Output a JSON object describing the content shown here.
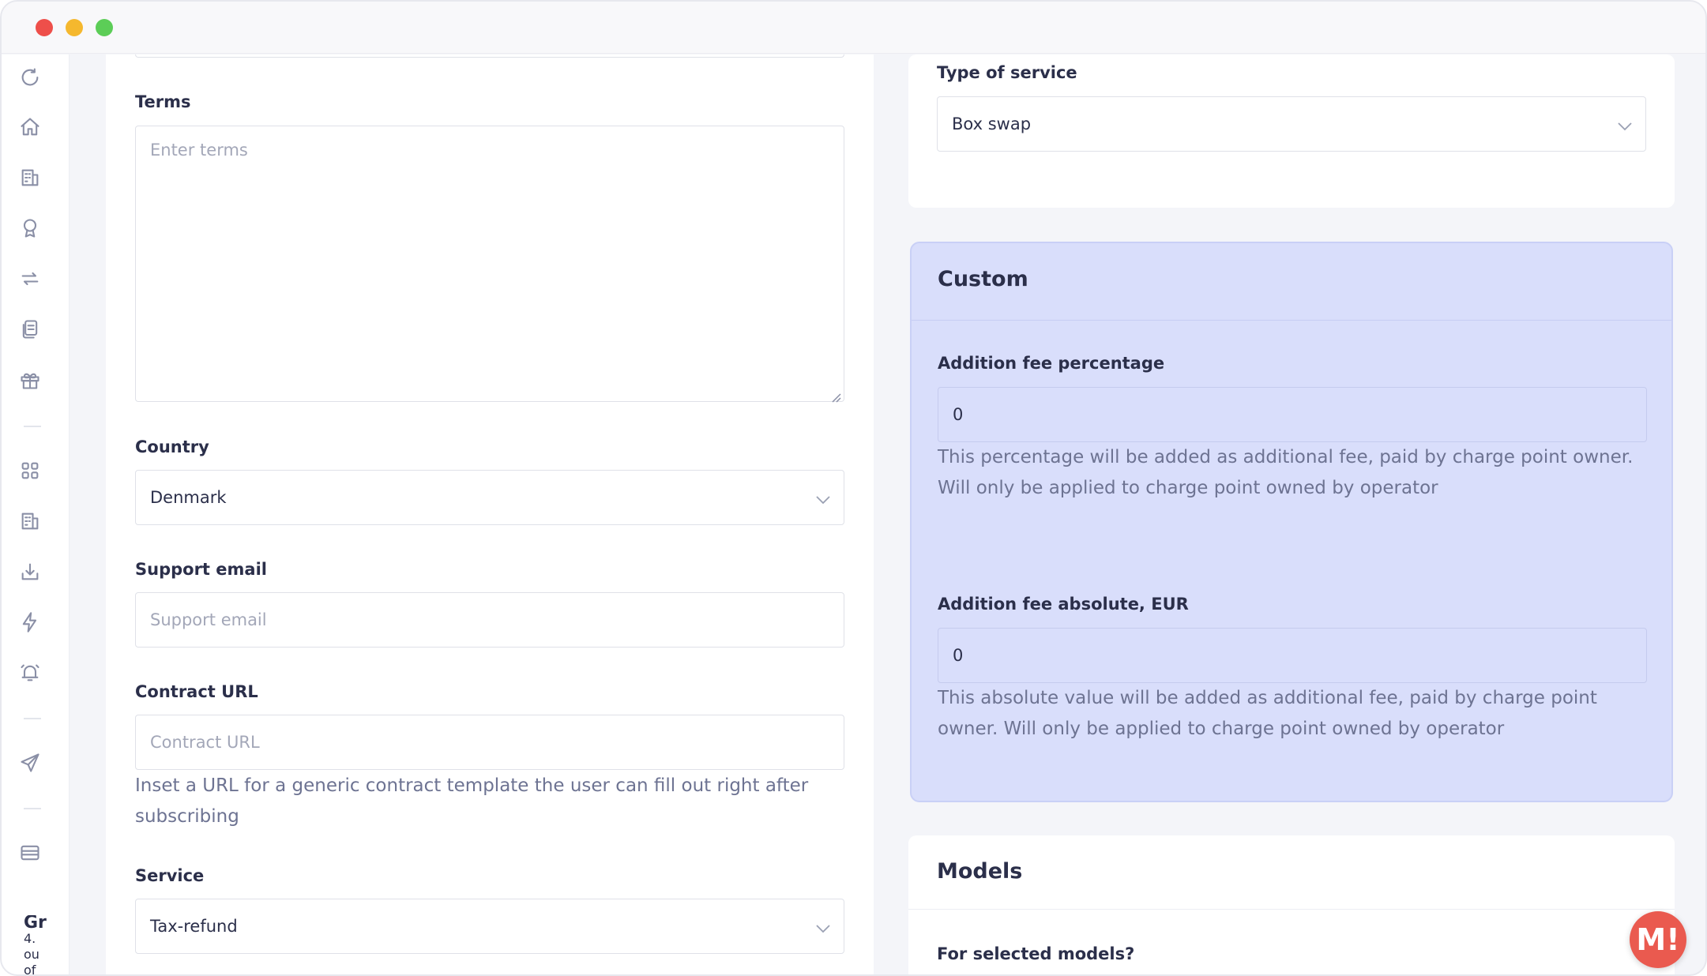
{
  "left_form": {
    "terms": {
      "label": "Terms",
      "placeholder": "Enter terms"
    },
    "country": {
      "label": "Country",
      "value": "Denmark"
    },
    "support_email": {
      "label": "Support email",
      "placeholder": "Support email"
    },
    "contract_url": {
      "label": "Contract URL",
      "placeholder": "Contract URL",
      "help": "Inset a URL for a generic contract template the user can fill out right after subscribing"
    },
    "service": {
      "label": "Service",
      "value": "Tax-refund"
    }
  },
  "type_of_service": {
    "label": "Type of service",
    "value": "Box swap"
  },
  "custom": {
    "title": "Custom",
    "fee_percentage": {
      "label": "Addition fee percentage",
      "value": "0",
      "help": "This percentage will be added as additional fee, paid by charge point owner. Will only be applied to charge point owned by operator"
    },
    "fee_absolute": {
      "label": "Addition fee absolute, EUR",
      "value": "0",
      "help": "This absolute value will be added as additional fee, paid by charge point owner. Will only be applied to charge point owned by operator"
    }
  },
  "models": {
    "title": "Models",
    "for_selected_label": "For selected models?"
  },
  "sidebar": {
    "icons": [
      "refresh-icon",
      "home-icon",
      "building-icon",
      "award-icon",
      "swap-icon",
      "documents-icon",
      "gift-icon",
      "grid-icon",
      "building-icon",
      "download-icon",
      "lightning-icon",
      "alarm-icon",
      "send-icon",
      "card-icon"
    ],
    "cut_text_lines": [
      "Gr",
      "4.",
      "ou",
      "of"
    ]
  },
  "fab": {
    "label": "M!"
  },
  "colors": {
    "accent_panel": "#d9defb",
    "fab": "#ea5a4f"
  }
}
